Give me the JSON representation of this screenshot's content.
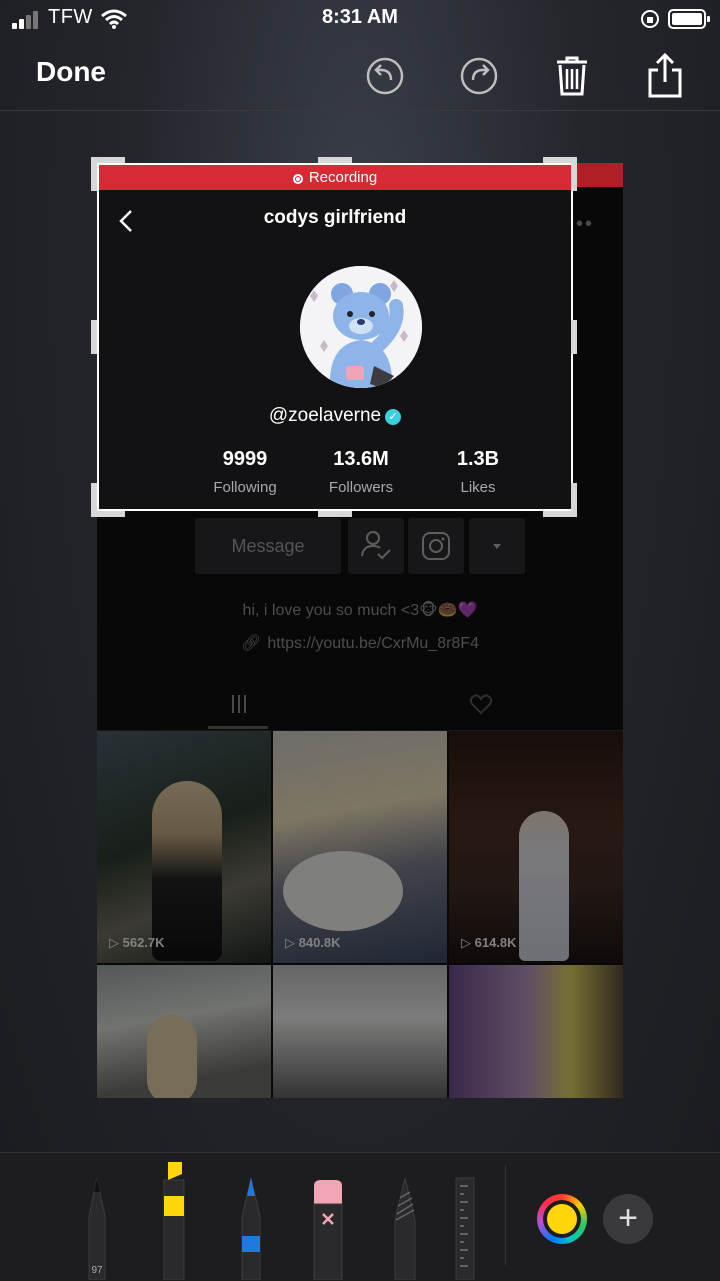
{
  "status_bar": {
    "carrier": "TFW",
    "time": "8:31 AM"
  },
  "toolbar": {
    "done_label": "Done",
    "icons": [
      "undo-icon",
      "redo-icon",
      "trash-icon",
      "share-icon"
    ]
  },
  "recording": {
    "label": "Recording",
    "title": "codys girlfriend",
    "username": "@zoelaverne",
    "stats": [
      {
        "value": "9999",
        "label": "Following"
      },
      {
        "value": "13.6M",
        "label": "Followers"
      },
      {
        "value": "1.3B",
        "label": "Likes"
      }
    ]
  },
  "profile": {
    "message_label": "Message",
    "bio": "hi, i love you so much <3🐵🍩💜",
    "link": "https://youtu.be/CxrMu_8r8F4"
  },
  "videos": [
    {
      "views": "562.7K"
    },
    {
      "views": "840.8K"
    },
    {
      "views": "614.8K"
    },
    {
      "views": ""
    },
    {
      "views": ""
    },
    {
      "views": ""
    }
  ],
  "tools": {
    "pen_width": "97"
  },
  "colors": {
    "recording_red": "#d72a35",
    "verified": "#3ccfe0",
    "highlighter": "#ffd60a",
    "pencil_blue": "#1f7ae0"
  }
}
